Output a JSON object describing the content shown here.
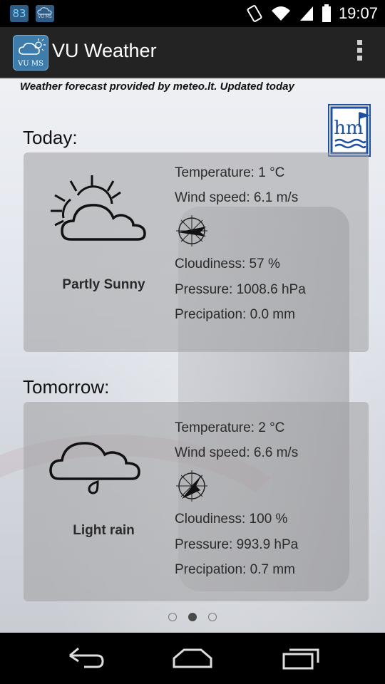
{
  "status_bar": {
    "badge_number": "83",
    "badge_caption": "VU MS",
    "time": "19:07"
  },
  "app_bar": {
    "icon_caption": "VU MS",
    "title": "VU Weather"
  },
  "forecast_note": "Weather forecast provided by meteo.lt. Updated today",
  "logo_text": "hm",
  "today": {
    "heading": "Today:",
    "condition": "Partly Sunny",
    "icon": "partly-sunny-icon",
    "temperature": "Temperature: 1 °C",
    "wind_speed": "Wind speed: 6.1 m/s",
    "cloudiness": "Cloudiness: 57 %",
    "pressure": "Pressure: 1008.6 hPa",
    "precipitation": "Precipation: 0.0 mm"
  },
  "tomorrow": {
    "heading": "Tomorrow:",
    "condition": "Light rain",
    "icon": "light-rain-icon",
    "temperature": "Temperature: 2 °C",
    "wind_speed": "Wind speed: 6.6 m/s",
    "cloudiness": "Cloudiness: 100 %",
    "pressure": "Pressure: 993.9 hPa",
    "precipitation": "Precipation: 0.7 mm"
  },
  "pager": {
    "pages": 3,
    "active_index": 1
  }
}
